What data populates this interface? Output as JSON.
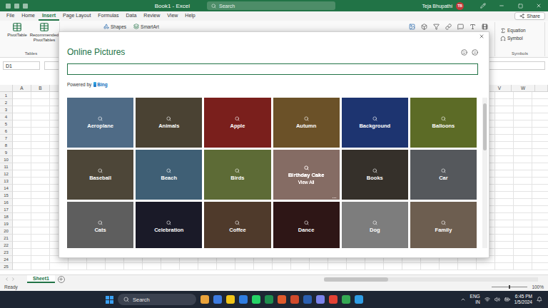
{
  "window": {
    "title": "Book1 - Excel",
    "search_placeholder": "Search",
    "user": "Teja Bhupathi",
    "avatar": "TB"
  },
  "ribbon": {
    "tabs": [
      {
        "label": "File",
        "selected": false
      },
      {
        "label": "Home",
        "selected": false
      },
      {
        "label": "Insert",
        "selected": true
      },
      {
        "label": "Page Layout",
        "selected": false
      },
      {
        "label": "Formulas",
        "selected": false
      },
      {
        "label": "Data",
        "selected": false
      },
      {
        "label": "Review",
        "selected": false
      },
      {
        "label": "View",
        "selected": false
      },
      {
        "label": "Help",
        "selected": false
      }
    ],
    "share": "Share",
    "tables_group": {
      "label": "Tables",
      "items": [
        "PivotTable",
        "Recommended PivotTables"
      ]
    },
    "middle_items": [
      "Shapes",
      "SmartArt"
    ],
    "symbols_group": {
      "label": "Symbols",
      "items": [
        "Equation",
        "Symbol"
      ]
    }
  },
  "formula_bar": {
    "name_box": "D1"
  },
  "sheet": {
    "columns_left": [
      "A",
      "B"
    ],
    "columns_right": [
      "V",
      "W"
    ],
    "rows": [
      "1",
      "2",
      "3",
      "4",
      "5",
      "6",
      "7",
      "8",
      "9",
      "10",
      "11",
      "12",
      "13",
      "14",
      "15",
      "16",
      "17",
      "18",
      "19",
      "20",
      "21",
      "22",
      "23",
      "24",
      "25"
    ]
  },
  "dialog": {
    "title": "Online Pictures",
    "search_value": "",
    "powered_by": "Powered by",
    "provider": "Bing",
    "hover_action": "View All",
    "hover_more": "...",
    "tiles": [
      {
        "label": "Aeroplane",
        "hovered": false,
        "color": "#4f6b86"
      },
      {
        "label": "Animals",
        "hovered": false,
        "color": "#4a4233"
      },
      {
        "label": "Apple",
        "hovered": false,
        "color": "#7a1f1c"
      },
      {
        "label": "Autumn",
        "hovered": false,
        "color": "#6b5128"
      },
      {
        "label": "Background",
        "hovered": false,
        "color": "#1d3470"
      },
      {
        "label": "Balloons",
        "hovered": false,
        "color": "#5c6b26"
      },
      {
        "label": "Baseball",
        "hovered": false,
        "color": "#4d4638"
      },
      {
        "label": "Beach",
        "hovered": false,
        "color": "#3f5f75"
      },
      {
        "label": "Birds",
        "hovered": false,
        "color": "#5d6b36"
      },
      {
        "label": "Birthday Cake",
        "hovered": true,
        "color": "#6a5650"
      },
      {
        "label": "Books",
        "hovered": false,
        "color": "#35302a"
      },
      {
        "label": "Car",
        "hovered": false,
        "color": "#55585c"
      },
      {
        "label": "Cats",
        "hovered": false,
        "color": "#5e5e5e"
      },
      {
        "label": "Celebration",
        "hovered": false,
        "color": "#1a1a28"
      },
      {
        "label": "Coffee",
        "hovered": false,
        "color": "#4f3a2b"
      },
      {
        "label": "Dance",
        "hovered": false,
        "color": "#2e1616"
      },
      {
        "label": "Dog",
        "hovered": false,
        "color": "#7d7d7d"
      },
      {
        "label": "Family",
        "hovered": false,
        "color": "#6d5e50"
      }
    ]
  },
  "sheet_tabs": [
    {
      "label": "Sheet1",
      "selected": true
    }
  ],
  "status_bar": {
    "status": "Ready",
    "zoom": "100%"
  },
  "taskbar": {
    "search_placeholder": "Search",
    "language": "ENG",
    "region": "IN",
    "time": "6:45 PM",
    "date": "1/5/2024"
  }
}
